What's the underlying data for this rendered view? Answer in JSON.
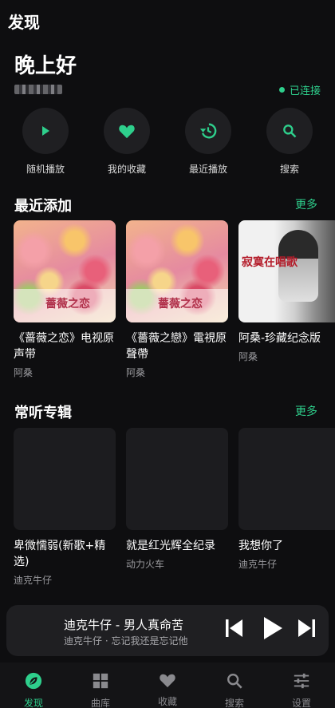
{
  "header": {
    "title": "发现"
  },
  "greeting": "晚上好",
  "status": "已连接",
  "quick_actions": [
    {
      "label": "随机播放",
      "icon": "play-icon"
    },
    {
      "label": "我的收藏",
      "icon": "heart-icon"
    },
    {
      "label": "最近播放",
      "icon": "history-icon"
    },
    {
      "label": "搜索",
      "icon": "search-icon"
    }
  ],
  "recent": {
    "title": "最近添加",
    "more": "更多",
    "items": [
      {
        "title": "《蔷薇之恋》电视原声带",
        "artist": "阿桑",
        "cover_text": "薔薇之恋"
      },
      {
        "title": "《薔薇之戀》電視原聲帶",
        "artist": "阿桑",
        "cover_text": "薔薇之恋"
      },
      {
        "title": "阿桑-珍藏纪念版",
        "artist": "阿桑",
        "cover_text": "寂寞在唱歌"
      }
    ]
  },
  "frequent": {
    "title": "常听专辑",
    "more": "更多",
    "items": [
      {
        "title": "卑微懦弱(新歌+精选)",
        "artist": "迪克牛仔"
      },
      {
        "title": "就是红光辉全纪录",
        "artist": "动力火车"
      },
      {
        "title": "我想你了",
        "artist": "迪克牛仔"
      }
    ]
  },
  "now_playing": {
    "song": "迪克牛仔 - 男人真命苦",
    "sub": "迪克牛仔 · 忘记我还是忘记他"
  },
  "tabs": [
    {
      "label": "发现",
      "icon": "discover-icon",
      "active": true
    },
    {
      "label": "曲库",
      "icon": "library-icon"
    },
    {
      "label": "收藏",
      "icon": "heart-icon"
    },
    {
      "label": "搜索",
      "icon": "search-icon"
    },
    {
      "label": "设置",
      "icon": "settings-sliders-icon"
    }
  ],
  "colors": {
    "accent": "#2ecf8c",
    "background": "#0e0e10",
    "surface": "#1f1f22"
  }
}
